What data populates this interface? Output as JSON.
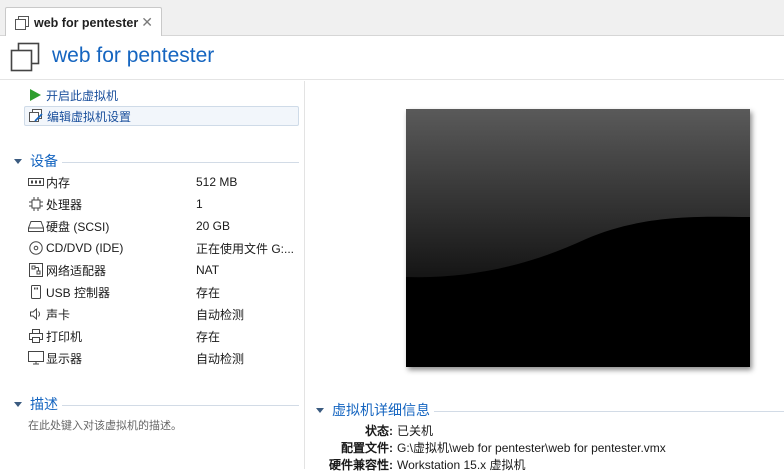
{
  "tab": {
    "label": "web for pentester",
    "close": "✕"
  },
  "header": {
    "title": "web for pentester"
  },
  "actions": [
    {
      "label": "开启此虚拟机",
      "icon": "play-icon"
    },
    {
      "label": "编辑虚拟机设置",
      "icon": "edit-settings-icon"
    }
  ],
  "devices_section": {
    "title": "设备"
  },
  "devices": [
    {
      "name": "内存",
      "value": "512 MB",
      "icon": "memory-icon"
    },
    {
      "name": "处理器",
      "value": "1",
      "icon": "cpu-icon"
    },
    {
      "name": "硬盘 (SCSI)",
      "value": "20 GB",
      "icon": "hard-disk-icon"
    },
    {
      "name": "CD/DVD (IDE)",
      "value": "正在使用文件 G:...",
      "icon": "cd-dvd-icon"
    },
    {
      "name": "网络适配器",
      "value": "NAT",
      "icon": "network-icon"
    },
    {
      "name": "USB 控制器",
      "value": "存在",
      "icon": "usb-icon"
    },
    {
      "name": "声卡",
      "value": "自动检测",
      "icon": "sound-icon"
    },
    {
      "name": "打印机",
      "value": "存在",
      "icon": "printer-icon"
    },
    {
      "name": "显示器",
      "value": "自动检测",
      "icon": "display-icon"
    }
  ],
  "description_section": {
    "title": "描述",
    "placeholder": "在此处键入对该虚拟机的描述。"
  },
  "details_section": {
    "title": "虚拟机详细信息",
    "rows": [
      {
        "key": "状态:",
        "value": "已关机"
      },
      {
        "key": "配置文件:",
        "value": "G:\\虚拟机\\web for pentester\\web for pentester.vmx"
      },
      {
        "key": "硬件兼容性:",
        "value": "Workstation 15.x 虚拟机"
      }
    ]
  },
  "colors": {
    "accent": "#1565c0",
    "play": "#2e9e2e",
    "screen": "#000000"
  }
}
